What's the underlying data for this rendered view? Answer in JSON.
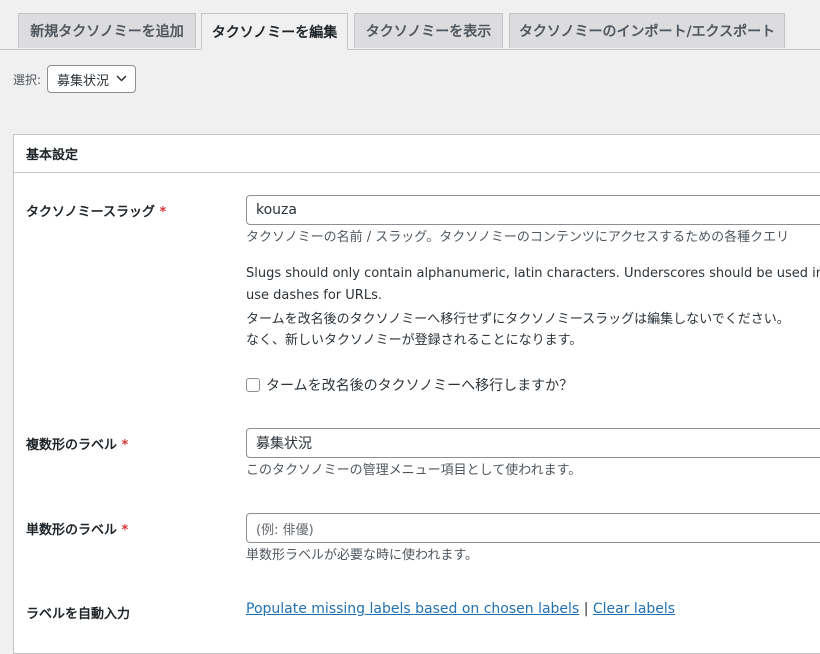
{
  "tabs": [
    {
      "label": "新規タクソノミーを追加"
    },
    {
      "label": "タクソノミーを編集"
    },
    {
      "label": "タクソノミーを表示"
    },
    {
      "label": "タクソノミーのインポート/エクスポート"
    }
  ],
  "selector": {
    "label": "選択:",
    "value": "募集状況"
  },
  "panel": {
    "title": "基本設定"
  },
  "fields": {
    "slug": {
      "label": "タクソノミースラッグ",
      "required": "*",
      "value": "kouza",
      "desc": "タクソノミーの名前 / スラッグ。タクソノミーのコンテンツにアクセスするための各種クエリ",
      "note_en_1": "Slugs should only contain alphanumeric, latin characters. Underscores should be used in",
      "note_en_2": "use dashes for URLs.",
      "note_ja_1": "タームを改名後のタクソノミーへ移行せずにタクソノミースラッグは編集しないでください。",
      "note_ja_2": "なく、新しいタクソノミーが登録されることになります。",
      "migrate_label": "タームを改名後のタクソノミーへ移行しますか？"
    },
    "plural": {
      "label": "複数形のラベル",
      "required": "*",
      "value": "募集状況",
      "desc": "このタクソノミーの管理メニュー項目として使われます。"
    },
    "singular": {
      "label": "単数形のラベル",
      "required": "*",
      "placeholder": "(例: 俳優)",
      "desc": "単数形ラベルが必要な時に使われます。"
    },
    "autofill": {
      "label": "ラベルを自動入力",
      "populate_link": "Populate missing labels based on chosen labels",
      "separator": "|",
      "clear_link": "Clear labels"
    }
  }
}
